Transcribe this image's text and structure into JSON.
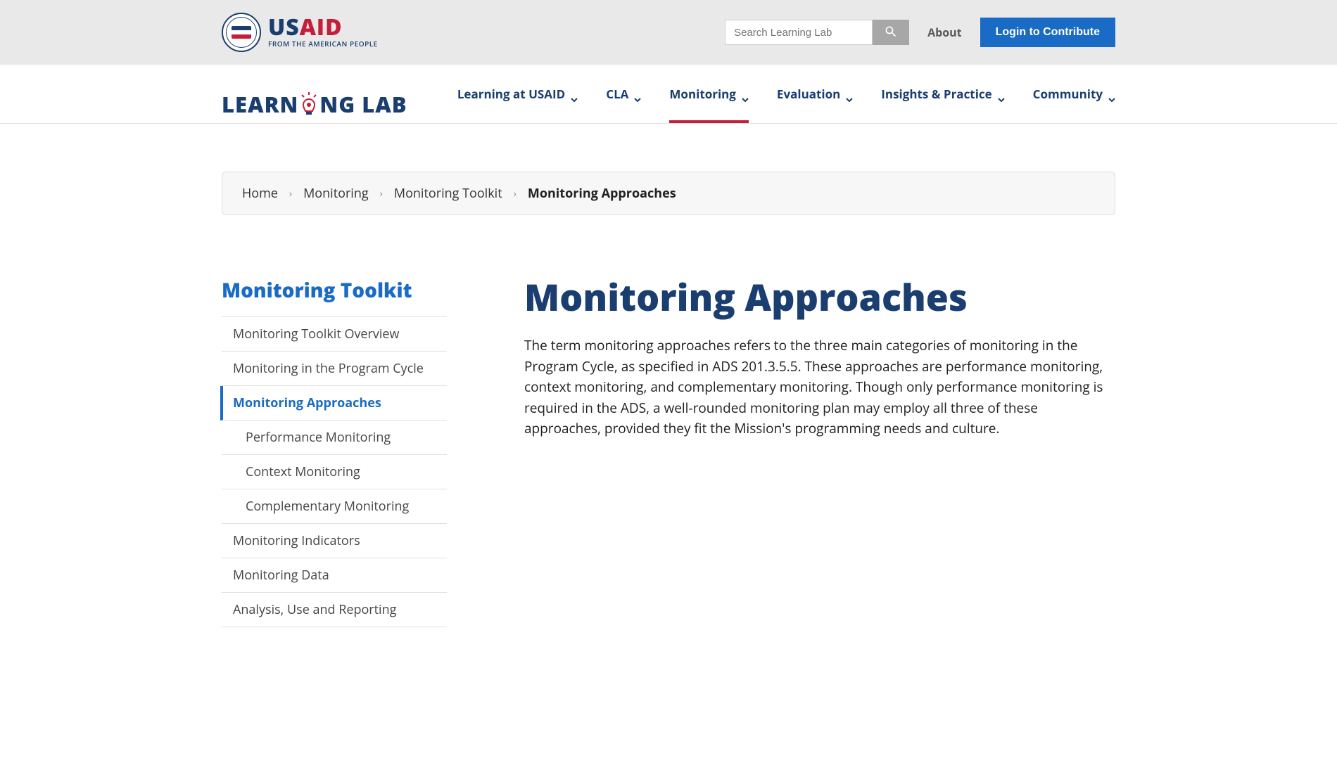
{
  "header": {
    "usaid_us": "US",
    "usaid_aid": "AID",
    "usaid_tag": "FROM THE AMERICAN PEOPLE",
    "search_placeholder": "Search Learning Lab",
    "about_label": "About",
    "login_label": "Login to Contribute"
  },
  "logo": {
    "part1": "LEARN",
    "part2": "NG LAB"
  },
  "nav": {
    "items": [
      {
        "label": "Learning at USAID",
        "active": false
      },
      {
        "label": "CLA",
        "active": false
      },
      {
        "label": "Monitoring",
        "active": true
      },
      {
        "label": "Evaluation",
        "active": false
      },
      {
        "label": "Insights & Practice",
        "active": false
      },
      {
        "label": "Community",
        "active": false
      }
    ]
  },
  "breadcrumb": {
    "items": [
      "Home",
      "Monitoring",
      "Monitoring Toolkit"
    ],
    "current": "Monitoring Approaches"
  },
  "sidebar": {
    "title": "Monitoring Toolkit",
    "items": [
      {
        "label": "Monitoring Toolkit Overview",
        "sub": false,
        "active": false
      },
      {
        "label": "Monitoring in the Program Cycle",
        "sub": false,
        "active": false
      },
      {
        "label": "Monitoring Approaches",
        "sub": false,
        "active": true
      },
      {
        "label": "Performance Monitoring",
        "sub": true,
        "active": false
      },
      {
        "label": "Context Monitoring",
        "sub": true,
        "active": false
      },
      {
        "label": "Complementary Monitoring",
        "sub": true,
        "active": false
      },
      {
        "label": "Monitoring Indicators",
        "sub": false,
        "active": false
      },
      {
        "label": "Monitoring Data",
        "sub": false,
        "active": false
      },
      {
        "label": "Analysis, Use and Reporting",
        "sub": false,
        "active": false
      }
    ]
  },
  "main": {
    "title": "Monitoring Approaches",
    "body": "The term monitoring approaches refers to the three main categories of monitoring in the Program Cycle, as specified in ADS 201.3.5.5. These approaches are performance monitoring, context monitoring, and complementary monitoring. Though only performance monitoring is required in the ADS, a well-rounded monitoring plan may employ all three of these approaches, provided they fit the Mission's programming needs and culture."
  }
}
